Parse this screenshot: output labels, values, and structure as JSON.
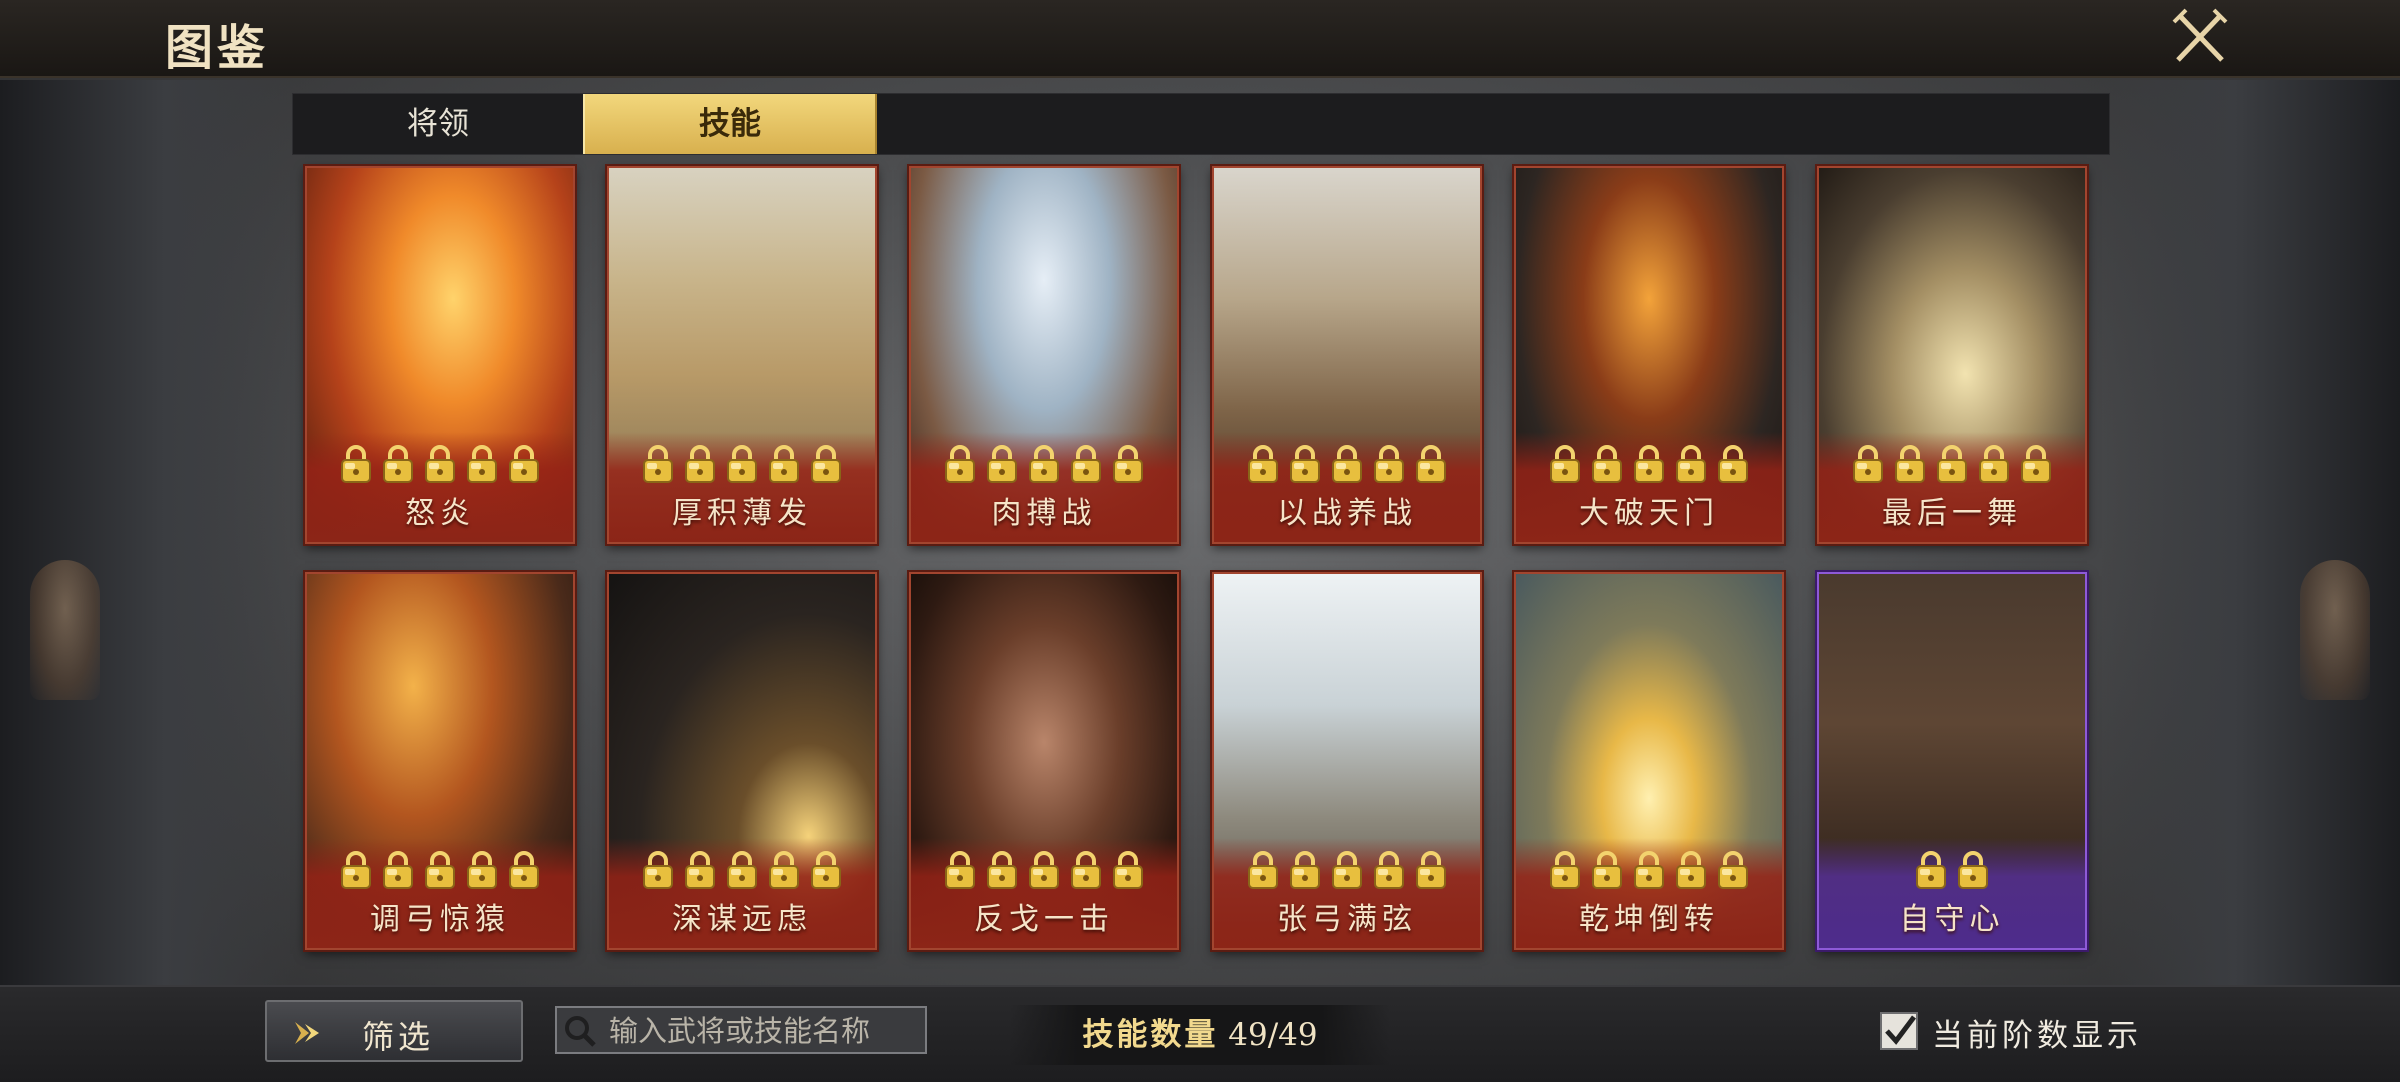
{
  "header": {
    "title": "图鉴",
    "close_icon": "crossed-swords-close-icon"
  },
  "tabs": [
    {
      "label": "将领",
      "active": false
    },
    {
      "label": "技能",
      "active": true
    }
  ],
  "cards": [
    {
      "name": "怒炎",
      "locks": 5,
      "theme": "fire"
    },
    {
      "name": "厚积薄发",
      "locks": 5,
      "theme": "army"
    },
    {
      "name": "肉搏战",
      "locks": 5,
      "theme": "duel"
    },
    {
      "name": "以战养战",
      "locks": 5,
      "theme": "battle"
    },
    {
      "name": "大破天门",
      "locks": 5,
      "theme": "burning-gate"
    },
    {
      "name": "最后一舞",
      "locks": 5,
      "theme": "dance"
    },
    {
      "name": "调弓惊猿",
      "locks": 5,
      "theme": "archer"
    },
    {
      "name": "深谋远虑",
      "locks": 5,
      "theme": "strategist"
    },
    {
      "name": "反戈一击",
      "locks": 5,
      "theme": "warrior"
    },
    {
      "name": "张弓满弦",
      "locks": 5,
      "theme": "bow"
    },
    {
      "name": "乾坤倒转",
      "locks": 5,
      "theme": "vortex"
    },
    {
      "name": "自守心",
      "locks": 2,
      "theme": "guard",
      "rarity": "purple"
    }
  ],
  "bottom": {
    "filter_label": "筛选",
    "search_placeholder": "输入武将或技能名称",
    "count_label": "技能数量",
    "count_value": "49/49",
    "toggle_label": "当前阶数显示",
    "toggle_checked": true
  },
  "colors": {
    "accent_gold": "#d8b04e",
    "card_red": "#8c2517",
    "card_purple": "#4e2c8c"
  }
}
